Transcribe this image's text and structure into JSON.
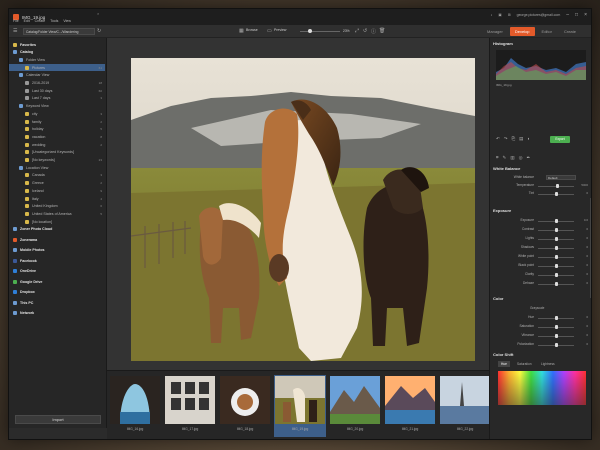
{
  "window": {
    "title": "IMG_19.jpg",
    "user_email": "george.pictures@gmail.com",
    "menu": [
      "File",
      "Edit",
      "Create",
      "Tools",
      "View"
    ]
  },
  "toolbar": {
    "path": "Catalog/Folder View/C.../Wandering",
    "browse_label": "Browse",
    "preview_label": "Preview",
    "zoom": "23%",
    "modes": [
      "Manager",
      "Develop",
      "Editor",
      "Create"
    ],
    "active_mode": "Develop"
  },
  "sidebar": {
    "items": [
      {
        "label": "Favorites",
        "count": "",
        "kind": "head",
        "color": "#d8b84a"
      },
      {
        "label": "Catalog",
        "count": "",
        "kind": "head",
        "color": "#6d9bd1"
      },
      {
        "label": "Folder View",
        "count": "",
        "kind": "sub",
        "color": "#6d9bd1"
      },
      {
        "label": "Pictures",
        "count": "61",
        "kind": "sel",
        "color": "#d8b84a"
      },
      {
        "label": "Calendar View",
        "count": "",
        "kind": "sub",
        "color": "#6d9bd1"
      },
      {
        "label": "2016-2019",
        "count": "18",
        "kind": "sub2",
        "color": "#999"
      },
      {
        "label": "Last 30 days",
        "count": "60",
        "kind": "sub2",
        "color": "#999"
      },
      {
        "label": "Last 7 days",
        "count": "3",
        "kind": "sub2",
        "color": "#999"
      },
      {
        "label": "Keyword View",
        "count": "",
        "kind": "sub",
        "color": "#6d9bd1"
      },
      {
        "label": "city",
        "count": "3",
        "kind": "sub2",
        "color": "#d8b84a"
      },
      {
        "label": "family",
        "count": "2",
        "kind": "sub2",
        "color": "#d8b84a"
      },
      {
        "label": "holiday",
        "count": "5",
        "kind": "sub2",
        "color": "#d8b84a"
      },
      {
        "label": "vacation",
        "count": "8",
        "kind": "sub2",
        "color": "#d8b84a"
      },
      {
        "label": "wedding",
        "count": "2",
        "kind": "sub2",
        "color": "#d8b84a"
      },
      {
        "label": "[Uncategorized Keywords]",
        "count": "",
        "kind": "sub2",
        "color": "#d8b84a"
      },
      {
        "label": "[No keywords]",
        "count": "23",
        "kind": "sub2",
        "color": "#d8b84a"
      },
      {
        "label": "Location View",
        "count": "",
        "kind": "sub",
        "color": "#6d9bd1"
      },
      {
        "label": "Canada",
        "count": "3",
        "kind": "sub2",
        "color": "#d8b84a"
      },
      {
        "label": "Greece",
        "count": "2",
        "kind": "sub2",
        "color": "#d8b84a"
      },
      {
        "label": "Iceland",
        "count": "9",
        "kind": "sub2",
        "color": "#d8b84a"
      },
      {
        "label": "Italy",
        "count": "4",
        "kind": "sub2",
        "color": "#d8b84a"
      },
      {
        "label": "United Kingdom",
        "count": "6",
        "kind": "sub2",
        "color": "#d8b84a"
      },
      {
        "label": "United States of America",
        "count": "5",
        "kind": "sub2",
        "color": "#d8b84a"
      },
      {
        "label": "[No location]",
        "count": "",
        "kind": "sub2",
        "color": "#d8b84a"
      },
      {
        "label": "Zoner Photo Cloud",
        "count": "",
        "kind": "head",
        "color": "#6d9bd1"
      },
      {
        "label": "Zonerama",
        "count": "",
        "kind": "head",
        "color": "#e35a2a"
      },
      {
        "label": "Mobile Photos",
        "count": "",
        "kind": "head",
        "color": "#6d9bd1"
      },
      {
        "label": "Facebook",
        "count": "",
        "kind": "head",
        "color": "#3b5998"
      },
      {
        "label": "OneDrive",
        "count": "",
        "kind": "head",
        "color": "#2f7fd8"
      },
      {
        "label": "Google Drive",
        "count": "",
        "kind": "head",
        "color": "#4caf50"
      },
      {
        "label": "Dropbox",
        "count": "",
        "kind": "head",
        "color": "#2f7fd8"
      },
      {
        "label": "This PC",
        "count": "",
        "kind": "head",
        "color": "#6d9bd1"
      },
      {
        "label": "Network",
        "count": "",
        "kind": "head",
        "color": "#6d9bd1"
      }
    ],
    "import_label": "Import"
  },
  "filmstrip": [
    {
      "label": "IMG_16.jpg",
      "scene": "cave"
    },
    {
      "label": "IMG_17.jpg",
      "scene": "frames"
    },
    {
      "label": "IMG_18.jpg",
      "scene": "food"
    },
    {
      "label": "IMG_19.jpg",
      "scene": "horses",
      "selected": true
    },
    {
      "label": "IMG_20.jpg",
      "scene": "mountain"
    },
    {
      "label": "IMG_21.jpg",
      "scene": "lake"
    },
    {
      "label": "IMG_22.jpg",
      "scene": "boat"
    }
  ],
  "right_panel": {
    "histogram_label": "Histogram",
    "file_info": "IMG_19.jpg",
    "export_label": "Export",
    "white_balance": {
      "title": "White Balance",
      "preset_label": "White balance",
      "preset_value": "Default",
      "rows": [
        {
          "label": "Temperature",
          "value": "5000",
          "pos": 0.55
        },
        {
          "label": "Tint",
          "value": "0",
          "pos": 0.5
        }
      ]
    },
    "exposure": {
      "title": "Exposure",
      "rows": [
        {
          "label": "Exposure",
          "value": "0.0",
          "pos": 0.5
        },
        {
          "label": "Contrast",
          "value": "0",
          "pos": 0.5
        },
        {
          "label": "Lights",
          "value": "0",
          "pos": 0.5
        },
        {
          "label": "Shadows",
          "value": "0",
          "pos": 0.5
        },
        {
          "label": "White point",
          "value": "0",
          "pos": 0.5
        },
        {
          "label": "Black point",
          "value": "0",
          "pos": 0.5
        },
        {
          "label": "Clarity",
          "value": "0",
          "pos": 0.5
        },
        {
          "label": "Dehaze",
          "value": "0",
          "pos": 0.5
        }
      ]
    },
    "color": {
      "title": "Color",
      "grayscale_label": "Grayscale",
      "rows": [
        {
          "label": "Hue",
          "value": "0",
          "pos": 0.5
        },
        {
          "label": "Saturation",
          "value": "0",
          "pos": 0.5
        },
        {
          "label": "Vibrance",
          "value": "0",
          "pos": 0.5
        },
        {
          "label": "Polarization",
          "value": "0",
          "pos": 0.5
        }
      ]
    },
    "color_shift": {
      "title": "Color Shift",
      "tabs": [
        "Hue",
        "Saturation",
        "Lightness"
      ]
    }
  }
}
